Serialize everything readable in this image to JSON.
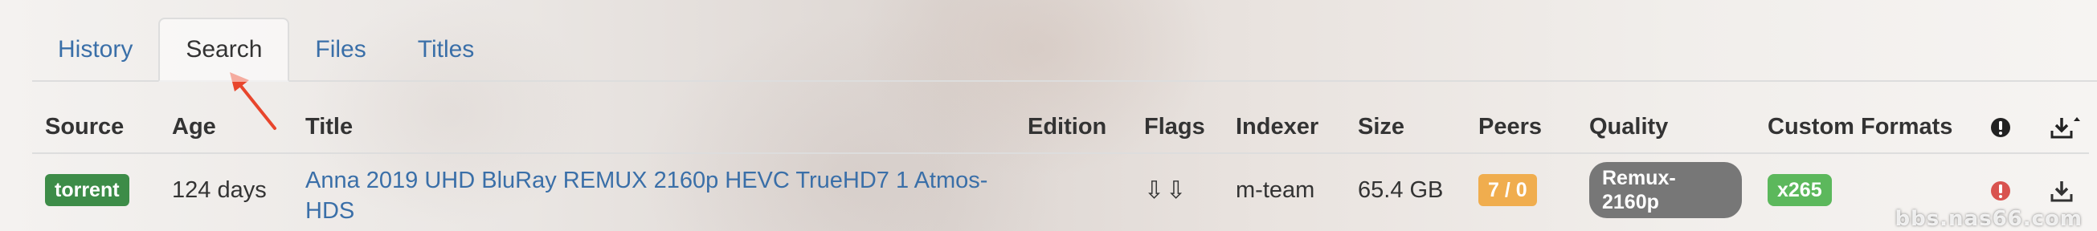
{
  "tabs": [
    {
      "label": "History",
      "active": false
    },
    {
      "label": "Search",
      "active": true
    },
    {
      "label": "Files",
      "active": false
    },
    {
      "label": "Titles",
      "active": false
    }
  ],
  "table": {
    "headers": {
      "source": "Source",
      "age": "Age",
      "title": "Title",
      "edition": "Edition",
      "flags": "Flags",
      "indexer": "Indexer",
      "size": "Size",
      "peers": "Peers",
      "quality": "Quality",
      "custom_formats": "Custom Formats",
      "status_icon": "exclamation-circle-icon",
      "download_icon": "download-sort-icon"
    },
    "rows": [
      {
        "source": "torrent",
        "age": "124 days",
        "title": "Anna 2019 UHD BluRay REMUX 2160p HEVC TrueHD7 1 Atmos-HDS",
        "edition": "",
        "flags": "⇩⇩",
        "indexer": "m-team",
        "size": "65.4 GB",
        "peers": "7 / 0",
        "quality": "Remux-2160p",
        "custom_format": "x265",
        "status_icon": "exclamation-circle-icon",
        "download_icon": "download-icon"
      }
    ]
  },
  "colors": {
    "link": "#3a6fa8",
    "torrent_badge": "#3d8c48",
    "peers_badge": "#f0ad4e",
    "quality_badge": "#777777",
    "custom_format_badge": "#5cb85c",
    "error_icon": "#d9534f",
    "annotation_arrow": "#e8452c"
  },
  "watermark": "bbs.nas66.com"
}
